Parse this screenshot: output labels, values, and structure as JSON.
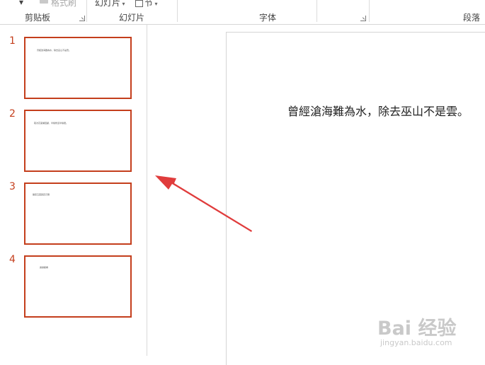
{
  "ribbon": {
    "format_painter_label": "格式刷",
    "slide_button_label": "幻灯片",
    "section_button_label": "节",
    "groups": [
      "剪贴板",
      "幻灯片",
      "字体",
      "段落"
    ]
  },
  "slides": [
    {
      "number": "1",
      "text": "曾經滄海難為水，除去巫山不是雲。"
    },
    {
      "number": "2",
      "text": "取次花叢懶回顧，半緣修道半緣君。"
    },
    {
      "number": "3",
      "text": "離思五首其四元稹"
    },
    {
      "number": "4",
      "text": "謝謝觀看"
    }
  ],
  "main_slide": {
    "text": "曾經滄海難為水，除去巫山不是雲。"
  },
  "watermark": {
    "logo": "Bai 经验",
    "url": "jingyan.baidu.com"
  },
  "colors": {
    "accent": "#c43e1c",
    "annotation_arrow": "#e03c3c"
  }
}
